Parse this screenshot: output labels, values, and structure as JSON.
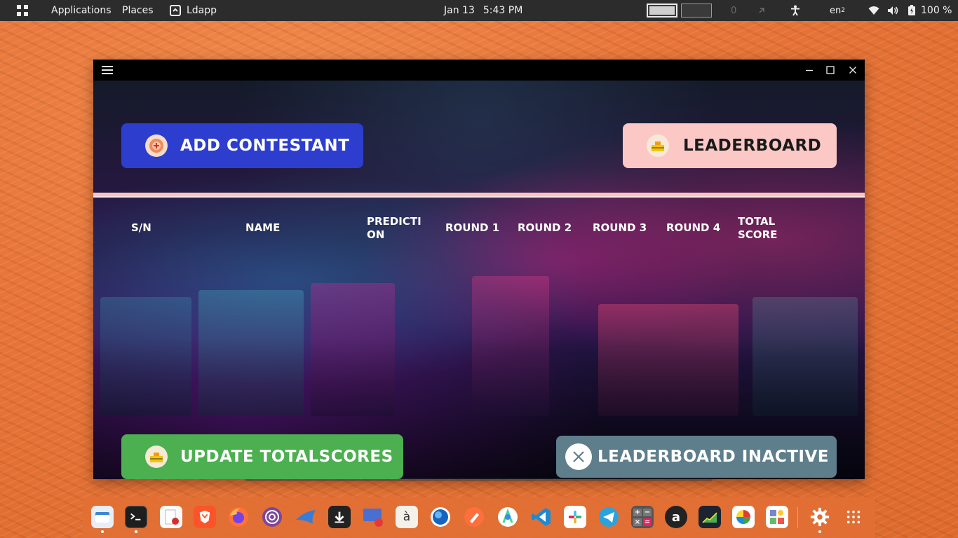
{
  "topbar": {
    "applications": "Applications",
    "places": "Places",
    "active_app": "Ldapp",
    "date": "Jan 13",
    "time": "5:43 PM",
    "notification_count": "0",
    "lang_main": "en",
    "lang_sub": "2",
    "battery": "100 %"
  },
  "window": {
    "buttons": {
      "add_contestant": "ADD CONTESTANT",
      "leaderboard": "LEADERBOARD",
      "update_totalscores": "UPDATE TOTALSCORES",
      "leaderboard_inactive": "LEADERBOARD INACTIVE"
    },
    "columns": [
      "S/N",
      "NAME",
      "PREDICTION",
      "ROUND 1",
      "ROUND 2",
      "ROUND 3",
      "ROUND 4",
      "TOTAL SCORE"
    ],
    "colors": {
      "add_button": "#2d3ecf",
      "leaderboard_button": "#fbc8c6",
      "update_button": "#4caf50",
      "inactive_button": "#5f7e8c",
      "divider": "#f9c4c2"
    }
  },
  "dock": {
    "apps": [
      "files-icon",
      "terminal-icon",
      "text-editor-icon",
      "brave-icon",
      "firefox-icon",
      "tor-browser-icon",
      "shark-app-icon",
      "download-manager-icon",
      "screen-recorder-icon",
      "character-map-icon",
      "globe-app-icon",
      "pen-app-icon",
      "android-studio-icon",
      "vscode-icon",
      "slack-icon",
      "telegram-icon",
      "calculator-icon",
      "amazon-icon",
      "system-monitor-icon",
      "color-picker-icon",
      "emoji-app-icon",
      "settings-icon",
      "show-apps-icon"
    ],
    "calculator_keys": [
      "+",
      "−",
      "×",
      "="
    ],
    "amazon_letter": "a"
  }
}
